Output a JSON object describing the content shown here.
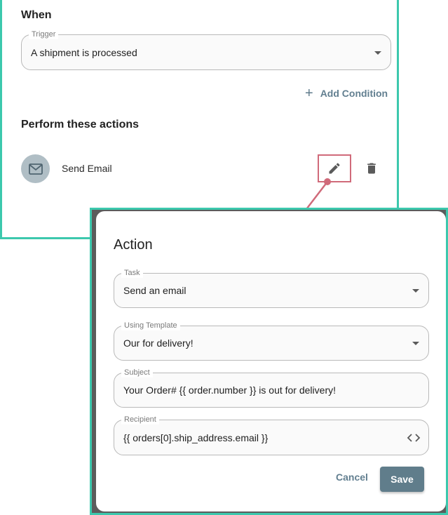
{
  "rule": {
    "when_title": "When",
    "trigger": {
      "label": "Trigger",
      "value": "A shipment is processed"
    },
    "add_condition": "Add Condition",
    "perform_title": "Perform these actions",
    "action": {
      "label": "Send Email",
      "icon": "mail-icon"
    }
  },
  "dialog": {
    "title": "Action",
    "task": {
      "label": "Task",
      "value": "Send an email"
    },
    "template": {
      "label": "Using Template",
      "value": "Our for delivery!"
    },
    "subject": {
      "label": "Subject",
      "value": "Your Order# {{ order.number }} is out for delivery!"
    },
    "recipient": {
      "label": "Recipient",
      "value": "{{ orders[0].ship_address.email }}"
    },
    "cancel": "Cancel",
    "save": "Save"
  },
  "colors": {
    "highlight_border": "#3cc8ad",
    "edit_highlight": "#d06a7a",
    "accent_text": "#627f90",
    "save_button": "#607d8b",
    "avatar_bg": "#b0bec5"
  }
}
